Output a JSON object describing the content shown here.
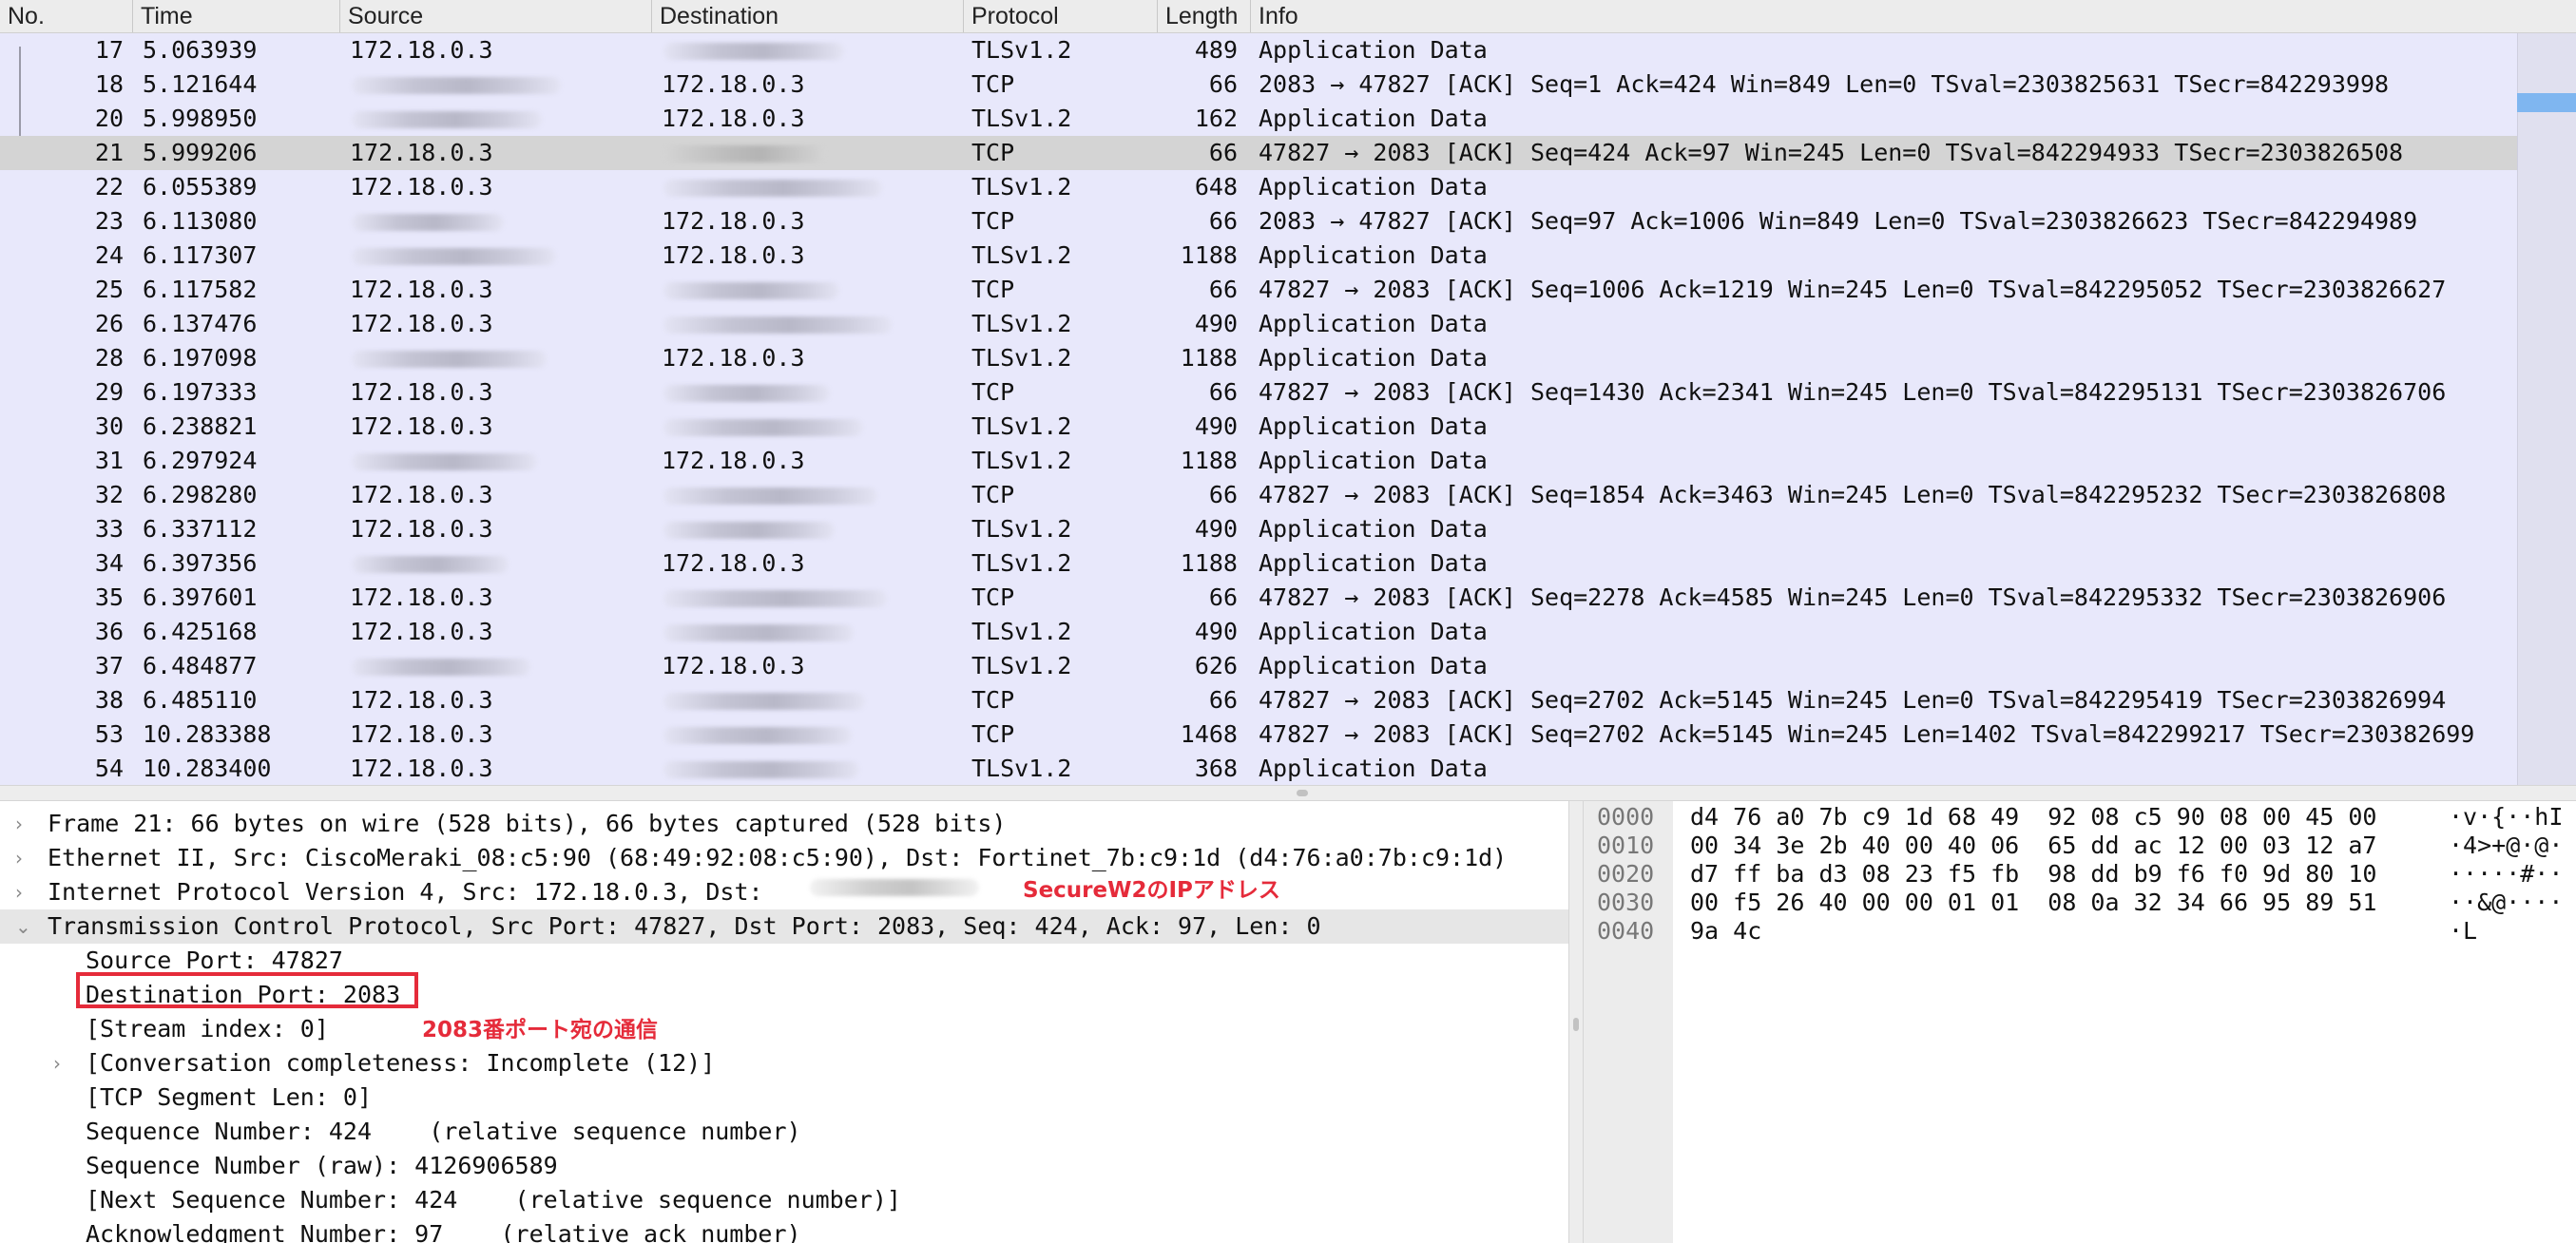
{
  "columns": {
    "no": "No.",
    "time": "Time",
    "source": "Source",
    "destination": "Destination",
    "protocol": "Protocol",
    "length": "Length",
    "info": "Info"
  },
  "packets": [
    {
      "no": "17",
      "time": "5.063939",
      "src": "172.18.0.3",
      "dst": "",
      "proto": "TLSv1.2",
      "len": "489",
      "info": "Application Data"
    },
    {
      "no": "18",
      "time": "5.121644",
      "src": "",
      "dst": "172.18.0.3",
      "proto": "TCP",
      "len": "66",
      "info": "2083 → 47827 [ACK] Seq=1 Ack=424 Win=849 Len=0 TSval=2303825631 TSecr=842293998"
    },
    {
      "no": "20",
      "time": "5.998950",
      "src": "",
      "dst": "172.18.0.3",
      "proto": "TLSv1.2",
      "len": "162",
      "info": "Application Data"
    },
    {
      "no": "21",
      "time": "5.999206",
      "src": "172.18.0.3",
      "dst": "",
      "proto": "TCP",
      "len": "66",
      "info": "47827 → 2083 [ACK] Seq=424 Ack=97 Win=245 Len=0 TSval=842294933 TSecr=2303826508",
      "selected": true
    },
    {
      "no": "22",
      "time": "6.055389",
      "src": "172.18.0.3",
      "dst": "",
      "proto": "TLSv1.2",
      "len": "648",
      "info": "Application Data"
    },
    {
      "no": "23",
      "time": "6.113080",
      "src": "",
      "dst": "172.18.0.3",
      "proto": "TCP",
      "len": "66",
      "info": "2083 → 47827 [ACK] Seq=97 Ack=1006 Win=849 Len=0 TSval=2303826623 TSecr=842294989"
    },
    {
      "no": "24",
      "time": "6.117307",
      "src": "",
      "dst": "172.18.0.3",
      "proto": "TLSv1.2",
      "len": "1188",
      "info": "Application Data"
    },
    {
      "no": "25",
      "time": "6.117582",
      "src": "172.18.0.3",
      "dst": "",
      "proto": "TCP",
      "len": "66",
      "info": "47827 → 2083 [ACK] Seq=1006 Ack=1219 Win=245 Len=0 TSval=842295052 TSecr=2303826627"
    },
    {
      "no": "26",
      "time": "6.137476",
      "src": "172.18.0.3",
      "dst": "",
      "proto": "TLSv1.2",
      "len": "490",
      "info": "Application Data"
    },
    {
      "no": "28",
      "time": "6.197098",
      "src": "",
      "dst": "172.18.0.3",
      "proto": "TLSv1.2",
      "len": "1188",
      "info": "Application Data"
    },
    {
      "no": "29",
      "time": "6.197333",
      "src": "172.18.0.3",
      "dst": "",
      "proto": "TCP",
      "len": "66",
      "info": "47827 → 2083 [ACK] Seq=1430 Ack=2341 Win=245 Len=0 TSval=842295131 TSecr=2303826706"
    },
    {
      "no": "30",
      "time": "6.238821",
      "src": "172.18.0.3",
      "dst": "",
      "proto": "TLSv1.2",
      "len": "490",
      "info": "Application Data"
    },
    {
      "no": "31",
      "time": "6.297924",
      "src": "",
      "dst": "172.18.0.3",
      "proto": "TLSv1.2",
      "len": "1188",
      "info": "Application Data"
    },
    {
      "no": "32",
      "time": "6.298280",
      "src": "172.18.0.3",
      "dst": "",
      "proto": "TCP",
      "len": "66",
      "info": "47827 → 2083 [ACK] Seq=1854 Ack=3463 Win=245 Len=0 TSval=842295232 TSecr=2303826808"
    },
    {
      "no": "33",
      "time": "6.337112",
      "src": "172.18.0.3",
      "dst": "",
      "proto": "TLSv1.2",
      "len": "490",
      "info": "Application Data"
    },
    {
      "no": "34",
      "time": "6.397356",
      "src": "",
      "dst": "172.18.0.3",
      "proto": "TLSv1.2",
      "len": "1188",
      "info": "Application Data"
    },
    {
      "no": "35",
      "time": "6.397601",
      "src": "172.18.0.3",
      "dst": "",
      "proto": "TCP",
      "len": "66",
      "info": "47827 → 2083 [ACK] Seq=2278 Ack=4585 Win=245 Len=0 TSval=842295332 TSecr=2303826906"
    },
    {
      "no": "36",
      "time": "6.425168",
      "src": "172.18.0.3",
      "dst": "",
      "proto": "TLSv1.2",
      "len": "490",
      "info": "Application Data"
    },
    {
      "no": "37",
      "time": "6.484877",
      "src": "",
      "dst": "172.18.0.3",
      "proto": "TLSv1.2",
      "len": "626",
      "info": "Application Data"
    },
    {
      "no": "38",
      "time": "6.485110",
      "src": "172.18.0.3",
      "dst": "",
      "proto": "TCP",
      "len": "66",
      "info": "47827 → 2083 [ACK] Seq=2702 Ack=5145 Win=245 Len=0 TSval=842295419 TSecr=2303826994"
    },
    {
      "no": "53",
      "time": "10.283388",
      "src": "172.18.0.3",
      "dst": "",
      "proto": "TCP",
      "len": "1468",
      "info": "47827 → 2083 [ACK] Seq=2702 Ack=5145 Win=245 Len=1402 TSval=842299217 TSecr=230382699"
    },
    {
      "no": "54",
      "time": "10.283400",
      "src": "172.18.0.3",
      "dst": "",
      "proto": "TLSv1.2",
      "len": "368",
      "info": "Application Data"
    }
  ],
  "details": [
    {
      "text": "Frame 21: 66 bytes on wire (528 bits), 66 bytes captured (528 bits)",
      "indent": 0,
      "arrow": "›"
    },
    {
      "text": "Ethernet II, Src: CiscoMeraki_08:c5:90 (68:49:92:08:c5:90), Dst: Fortinet_7b:c9:1d (d4:76:a0:7b:c9:1d)",
      "indent": 0,
      "arrow": "›"
    },
    {
      "text": "Internet Protocol Version 4, Src: 172.18.0.3, Dst:",
      "indent": 0,
      "arrow": "›"
    },
    {
      "text": "Transmission Control Protocol, Src Port: 47827, Dst Port: 2083, Seq: 424, Ack: 97, Len: 0",
      "indent": 0,
      "arrow": "⌄",
      "highlight": true
    },
    {
      "text": "Source Port: 47827",
      "indent": 1,
      "arrow": ""
    },
    {
      "text": "Destination Port: 2083",
      "indent": 1,
      "arrow": ""
    },
    {
      "text": "[Stream index: 0]",
      "indent": 1,
      "arrow": ""
    },
    {
      "text": "[Conversation completeness: Incomplete (12)]",
      "indent": 1,
      "arrow": "›"
    },
    {
      "text": "[TCP Segment Len: 0]",
      "indent": 1,
      "arrow": ""
    },
    {
      "text": "Sequence Number: 424    (relative sequence number)",
      "indent": 1,
      "arrow": ""
    },
    {
      "text": "Sequence Number (raw): 4126906589",
      "indent": 1,
      "arrow": ""
    },
    {
      "text": "[Next Sequence Number: 424    (relative sequence number)]",
      "indent": 1,
      "arrow": ""
    },
    {
      "text": "Acknowledgment Number: 97    (relative ack number)",
      "indent": 1,
      "arrow": ""
    }
  ],
  "bytes": [
    {
      "offset": "0000",
      "hex": "d4 76 a0 7b c9 1d 68 49  92 08 c5 90 08 00 45 00",
      "ascii": "·v·{··hI"
    },
    {
      "offset": "0010",
      "hex": "00 34 3e 2b 40 00 40 06  65 dd ac 12 00 03 12 a7",
      "ascii": "·4>+@·@·"
    },
    {
      "offset": "0020",
      "hex": "d7 ff ba d3 08 23 f5 fb  98 dd b9 f6 f0 9d 80 10",
      "ascii": "·····#··"
    },
    {
      "offset": "0030",
      "hex": "00 f5 26 40 00 00 01 01  08 0a 32 34 66 95 89 51",
      "ascii": "··&@····"
    },
    {
      "offset": "0040",
      "hex": "9a 4c",
      "ascii": "·L"
    }
  ],
  "annotations": {
    "securew2_ip": "SecureW2のIPアドレス",
    "port_2083": "2083番ポート宛の通信"
  },
  "colors": {
    "accent_red": "#e52b3a",
    "row_bg": "#e8e8fb",
    "selected_row": "#d4d4d4",
    "scroll_marker": "#7fb6f0"
  }
}
